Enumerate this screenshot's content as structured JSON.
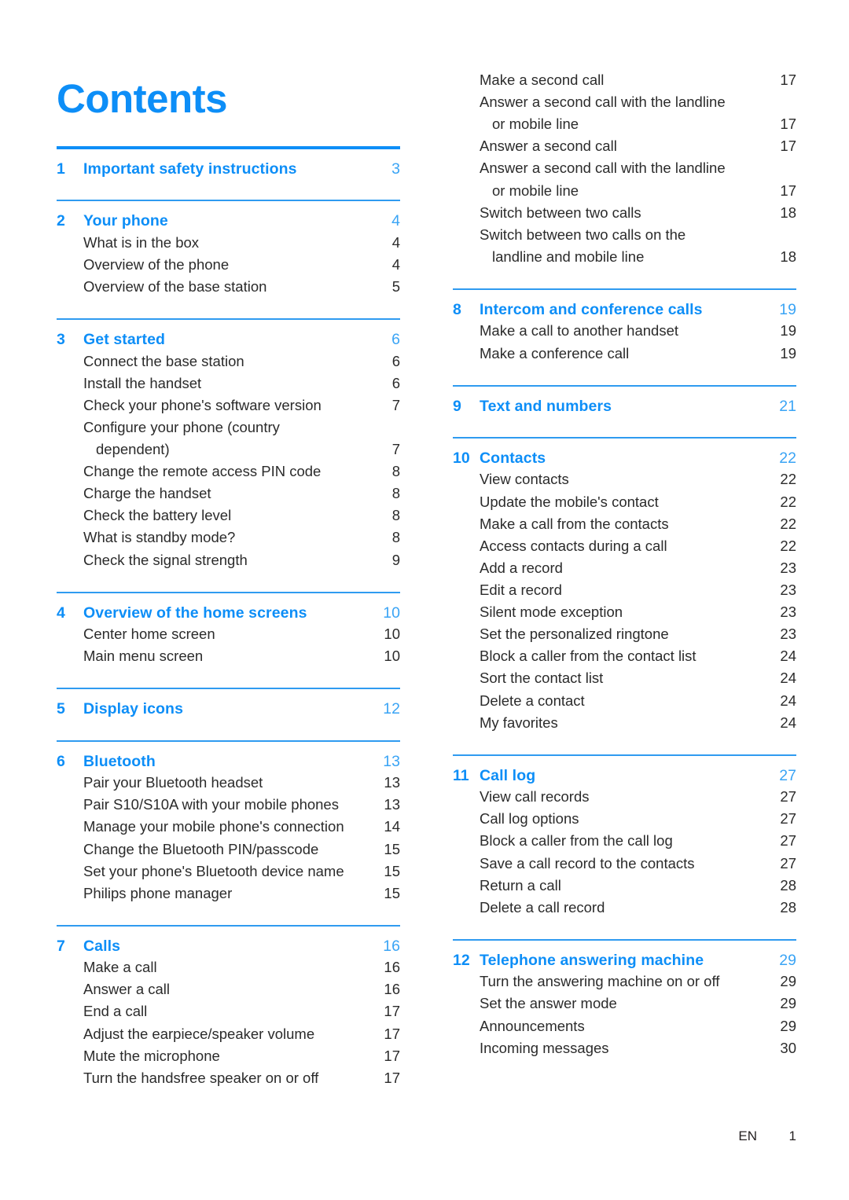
{
  "document": {
    "title": "Contents",
    "accent_color": "#0d8ef7",
    "rule_color": "#2f9bf0",
    "text_color": "#2b2b2b"
  },
  "footer": {
    "language": "EN",
    "page_number": "1"
  },
  "left_column": [
    {
      "rule": "thick",
      "number": "1",
      "title": "Important safety instructions",
      "page": "3",
      "entries": []
    },
    {
      "rule": "thin",
      "number": "2",
      "title": "Your phone",
      "page": "4",
      "entries": [
        {
          "label": "What is in the box",
          "page": "4"
        },
        {
          "label": "Overview of the phone",
          "page": "4"
        },
        {
          "label": "Overview of the base station",
          "page": "5"
        }
      ]
    },
    {
      "rule": "thin",
      "number": "3",
      "title": "Get started",
      "page": "6",
      "entries": [
        {
          "label": "Connect the base station",
          "page": "6"
        },
        {
          "label": "Install the handset",
          "page": "6"
        },
        {
          "label": "Check your phone's software version",
          "page": "7"
        },
        {
          "label": "Configure your phone (country",
          "cont": "dependent)",
          "page": "7"
        },
        {
          "label": "Change the remote access PIN code",
          "page": "8"
        },
        {
          "label": "Charge the handset",
          "page": "8"
        },
        {
          "label": "Check the battery level",
          "page": "8"
        },
        {
          "label": "What is standby mode?",
          "page": "8"
        },
        {
          "label": "Check the signal strength",
          "page": "9"
        }
      ]
    },
    {
      "rule": "thin",
      "number": "4",
      "title": "Overview of the home screens",
      "page": "10",
      "entries": [
        {
          "label": "Center home screen",
          "page": "10"
        },
        {
          "label": "Main menu screen",
          "page": "10"
        }
      ]
    },
    {
      "rule": "thin",
      "number": "5",
      "title": "Display icons",
      "page": "12",
      "entries": []
    },
    {
      "rule": "thin",
      "number": "6",
      "title": "Bluetooth",
      "page": "13",
      "entries": [
        {
          "label": "Pair your Bluetooth headset",
          "page": "13"
        },
        {
          "label": "Pair S10/S10A with your mobile phones",
          "page": "13"
        },
        {
          "label": "Manage your mobile phone's connection",
          "page": "14"
        },
        {
          "label": "Change the Bluetooth PIN/passcode",
          "page": "15"
        },
        {
          "label": "Set your phone's Bluetooth device name",
          "page": "15"
        },
        {
          "label": "Philips phone manager",
          "page": "15"
        }
      ]
    },
    {
      "rule": "thin",
      "number": "7",
      "title": "Calls",
      "page": "16",
      "entries": [
        {
          "label": "Make a call",
          "page": "16"
        },
        {
          "label": "Answer a call",
          "page": "16"
        },
        {
          "label": "End a call",
          "page": "17"
        },
        {
          "label": "Adjust the earpiece/speaker volume",
          "page": "17"
        },
        {
          "label": "Mute the microphone",
          "page": "17"
        },
        {
          "label": "Turn the handsfree speaker on or off",
          "page": "17"
        }
      ]
    }
  ],
  "right_column_continued": [
    {
      "label": "Make a second call",
      "page": "17"
    },
    {
      "label": "Answer a second call with the landline",
      "cont": "or mobile line",
      "page": "17"
    },
    {
      "label": "Answer a second call",
      "page": "17"
    },
    {
      "label": "Answer a second call with the landline",
      "cont": "or mobile line",
      "page": "17"
    },
    {
      "label": "Switch between two calls",
      "page": "18"
    },
    {
      "label": "Switch between two calls on the",
      "cont": "landline and mobile line",
      "page": "18"
    }
  ],
  "right_column": [
    {
      "rule": "thin",
      "number": "8",
      "title": "Intercom and conference calls",
      "page": "19",
      "entries": [
        {
          "label": "Make a call to another handset",
          "page": "19"
        },
        {
          "label": "Make a conference call",
          "page": "19"
        }
      ]
    },
    {
      "rule": "thin",
      "number": "9",
      "title": "Text and numbers",
      "page": "21",
      "entries": []
    },
    {
      "rule": "thin",
      "number": "10",
      "title": "Contacts",
      "page": "22",
      "entries": [
        {
          "label": "View contacts",
          "page": "22"
        },
        {
          "label": "Update the mobile's contact",
          "page": "22"
        },
        {
          "label": "Make a call from the contacts",
          "page": "22"
        },
        {
          "label": "Access contacts during a call",
          "page": "22"
        },
        {
          "label": "Add a record",
          "page": "23"
        },
        {
          "label": "Edit a record",
          "page": "23"
        },
        {
          "label": "Silent mode exception",
          "page": "23"
        },
        {
          "label": "Set the personalized ringtone",
          "page": "23"
        },
        {
          "label": "Block a caller from the contact list",
          "page": "24"
        },
        {
          "label": "Sort the contact list",
          "page": "24"
        },
        {
          "label": "Delete a contact",
          "page": "24"
        },
        {
          "label": "My favorites",
          "page": "24"
        }
      ]
    },
    {
      "rule": "thin",
      "number": "11",
      "title": "Call log",
      "page": "27",
      "entries": [
        {
          "label": "View call records",
          "page": "27"
        },
        {
          "label": "Call log options",
          "page": "27"
        },
        {
          "label": "Block a caller from the call log",
          "page": "27"
        },
        {
          "label": "Save a call record to the contacts",
          "page": "27"
        },
        {
          "label": "Return a call",
          "page": "28"
        },
        {
          "label": "Delete a call record",
          "page": "28"
        }
      ]
    },
    {
      "rule": "thin",
      "number": "12",
      "title": "Telephone answering machine",
      "page": "29",
      "entries": [
        {
          "label": "Turn the answering machine on or off",
          "page": "29"
        },
        {
          "label": "Set the answer mode",
          "page": "29"
        },
        {
          "label": "Announcements",
          "page": "29"
        },
        {
          "label": "Incoming messages",
          "page": "30"
        }
      ]
    }
  ]
}
